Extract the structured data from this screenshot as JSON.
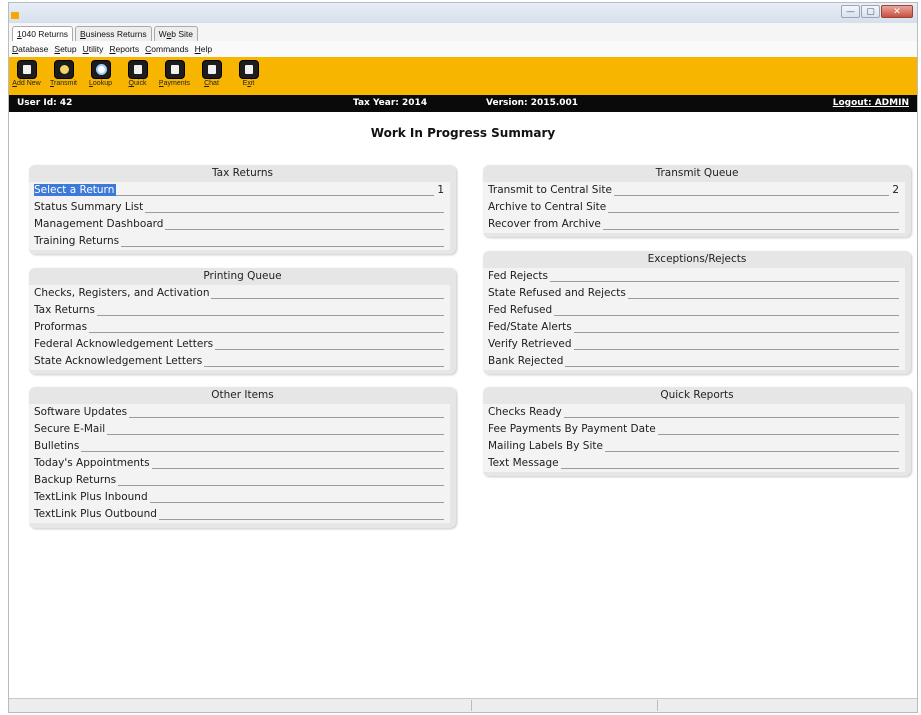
{
  "window": {
    "controls": {
      "minimize": "—",
      "maximize": "▢",
      "close": "✕"
    }
  },
  "tabs": [
    {
      "label": "1040 Returns",
      "accel": "1",
      "rest": "040 Returns",
      "active": true
    },
    {
      "label": "Business Returns",
      "accel": "B",
      "rest": "usiness Returns",
      "active": false
    },
    {
      "label": "Web Site",
      "pre": "W",
      "accel": "e",
      "rest": "b Site",
      "active": false
    }
  ],
  "menu": [
    {
      "accel": "D",
      "rest": "atabase"
    },
    {
      "accel": "S",
      "rest": "etup"
    },
    {
      "accel": "U",
      "rest": "tility"
    },
    {
      "accel": "R",
      "rest": "eports"
    },
    {
      "accel": "C",
      "rest": "ommands"
    },
    {
      "accel": "H",
      "rest": "elp"
    }
  ],
  "toolbar": [
    {
      "pre": "",
      "accel": "A",
      "rest": "dd New",
      "icon": "add-new-icon"
    },
    {
      "pre": "",
      "accel": "T",
      "rest": "ransmit",
      "icon": "transmit-icon"
    },
    {
      "pre": "",
      "accel": "L",
      "rest": "ookup",
      "icon": "lookup-icon"
    },
    {
      "pre": "",
      "accel": "Q",
      "rest": "uick",
      "icon": "quick-icon"
    },
    {
      "pre": "",
      "accel": "P",
      "rest": "ayments",
      "icon": "payments-icon"
    },
    {
      "pre": "",
      "accel": "C",
      "rest": "hat",
      "icon": "chat-icon"
    },
    {
      "pre": "E",
      "accel": "x",
      "rest": "it",
      "icon": "exit-icon"
    }
  ],
  "status": {
    "user": "User Id: 42",
    "tax_year": "Tax Year: 2014",
    "version": "Version: 2015.001",
    "logout": "Logout: ADMIN"
  },
  "page_title": "Work In Progress Summary",
  "panels": {
    "tax_returns": {
      "title": "Tax Returns",
      "rows": [
        {
          "label": "Select a Return",
          "count": "1",
          "selected": true
        },
        {
          "label": "Status Summary List",
          "count": ""
        },
        {
          "label": "Management Dashboard",
          "count": ""
        },
        {
          "label": "Training Returns",
          "count": ""
        }
      ]
    },
    "printing_queue": {
      "title": "Printing Queue",
      "rows": [
        {
          "label": "Checks, Registers, and Activation"
        },
        {
          "label": "Tax Returns"
        },
        {
          "label": "Proformas"
        },
        {
          "label": "Federal Acknowledgement Letters"
        },
        {
          "label": "State Acknowledgement Letters"
        }
      ]
    },
    "other_items": {
      "title": "Other Items",
      "rows": [
        {
          "label": "Software Updates"
        },
        {
          "label": "Secure E-Mail"
        },
        {
          "label": "Bulletins"
        },
        {
          "label": "Today's Appointments"
        },
        {
          "label": "Backup Returns"
        },
        {
          "label": "TextLink Plus Inbound"
        },
        {
          "label": "TextLink Plus Outbound"
        }
      ]
    },
    "transmit_queue": {
      "title": "Transmit Queue",
      "rows": [
        {
          "label": "Transmit to Central Site",
          "count": "2"
        },
        {
          "label": "Archive to Central Site",
          "count": ""
        },
        {
          "label": "Recover from Archive",
          "count": ""
        }
      ]
    },
    "exceptions_rejects": {
      "title": "Exceptions/Rejects",
      "rows": [
        {
          "label": "Fed Rejects"
        },
        {
          "label": "State Refused and Rejects"
        },
        {
          "label": "Fed Refused"
        },
        {
          "label": "Fed/State Alerts"
        },
        {
          "label": "Verify Retrieved"
        },
        {
          "label": "Bank Rejected"
        }
      ]
    },
    "quick_reports": {
      "title": "Quick Reports",
      "rows": [
        {
          "label": "Checks Ready"
        },
        {
          "label": "Fee Payments By Payment Date"
        },
        {
          "label": "Mailing Labels By Site"
        },
        {
          "label": "Text Message"
        }
      ]
    }
  }
}
